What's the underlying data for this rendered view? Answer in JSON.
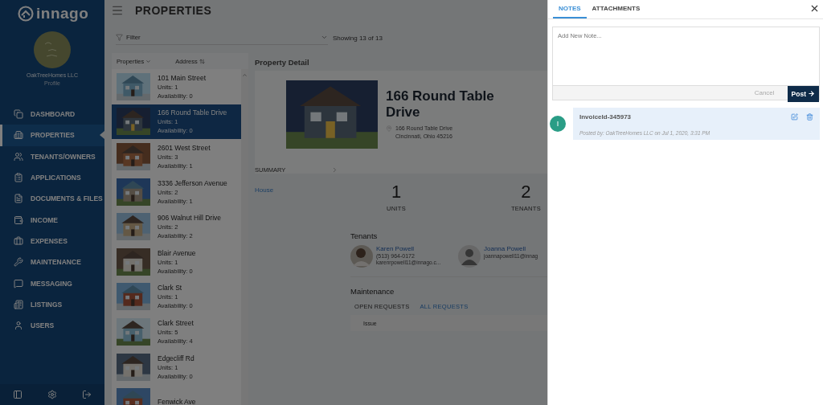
{
  "sidebar": {
    "brand": "innago",
    "account": {
      "name": "OakTreeHomes LLC",
      "link": "Profile"
    },
    "items": [
      {
        "label": "DASHBOARD",
        "selected": false
      },
      {
        "label": "PROPERTIES",
        "selected": true
      },
      {
        "label": "TENANTS/OWNERS",
        "selected": false
      },
      {
        "label": "APPLICATIONS",
        "selected": false
      },
      {
        "label": "DOCUMENTS & FILES",
        "selected": false
      },
      {
        "label": "INCOME",
        "selected": false
      },
      {
        "label": "EXPENSES",
        "selected": false
      },
      {
        "label": "MAINTENANCE",
        "selected": false
      },
      {
        "label": "MESSAGING",
        "selected": false
      },
      {
        "label": "LISTINGS",
        "selected": false
      },
      {
        "label": "USERS",
        "selected": false
      }
    ]
  },
  "header": {
    "title": "PROPERTIES"
  },
  "filter": {
    "placeholder": "Filter",
    "count": "Showing 13 of 13"
  },
  "list": {
    "columns": [
      "Properties",
      "Address"
    ],
    "properties": [
      {
        "name": "101 Main Street",
        "units": "Units: 1",
        "availability": "Availability: 0",
        "selected": false
      },
      {
        "name": "166 Round Table Drive",
        "units": "Units: 1",
        "availability": "Availability: 0",
        "selected": true
      },
      {
        "name": "2601 West Street",
        "units": "Units: 3",
        "availability": "Availability: 1",
        "selected": false
      },
      {
        "name": "3336 Jefferson Avenue",
        "units": "Units: 2",
        "availability": "Availability: 1",
        "selected": false
      },
      {
        "name": "906 Walnut Hill Drive",
        "units": "Units: 2",
        "availability": "Availability: 2",
        "selected": false
      },
      {
        "name": "Blair Avenue",
        "units": "Units: 1",
        "availability": "Availability: 0",
        "selected": false
      },
      {
        "name": "Clark St",
        "units": "Units: 1",
        "availability": "Availability: 0",
        "selected": false
      },
      {
        "name": "Clark Street",
        "units": "Units: 5",
        "availability": "Availability: 4",
        "selected": false
      },
      {
        "name": "Edgecliff Rd",
        "units": "Units: 1",
        "availability": "Availability: 0",
        "selected": false
      },
      {
        "name": "Fenwick Ave",
        "selected": false
      }
    ]
  },
  "detail": {
    "heading": "Property Detail",
    "title": "166 Round Table Drive",
    "address": [
      "166 Round Table Drive",
      "Cincinnati, Ohio 45216"
    ],
    "summary": "SUMMARY",
    "type": "House",
    "stats": [
      {
        "value": "1",
        "label": "UNITS"
      },
      {
        "value": "2",
        "label": "TENANTS"
      }
    ],
    "tenants_heading": "Tenants",
    "tenants": [
      {
        "name": "Karen Powell",
        "phone": "(513) 964-0172",
        "email": "karenrpowell11@innago.c..."
      },
      {
        "kind": "silhouette",
        "name": "Joanna Powell",
        "email": "joannapowell11@innag"
      }
    ],
    "maintenance": {
      "heading": "Maintenance",
      "tabs": [
        {
          "label": "OPEN REQUESTS",
          "selected": false
        },
        {
          "label": "ALL REQUESTS",
          "selected": true
        }
      ],
      "columns": [
        "Issue"
      ]
    }
  },
  "drawer": {
    "tabs": [
      {
        "label": "NOTES",
        "selected": true
      },
      {
        "label": "ATTACHMENTS",
        "selected": false
      }
    ],
    "note_field": {
      "placeholder": "Add New Note..."
    },
    "cancel": "Cancel",
    "post": "Post",
    "notes": [
      {
        "initial": "I",
        "title": "InvoiceId-345973",
        "meta": "Posted by: OakTreeHomes LLC on Jul 1, 2020, 3:31 PM"
      }
    ]
  }
}
